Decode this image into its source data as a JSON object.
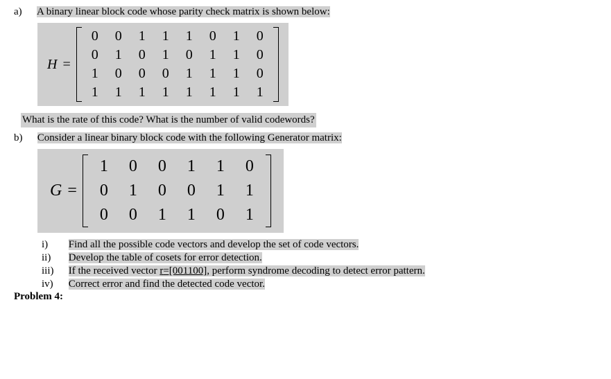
{
  "a": {
    "label": "a)",
    "intro": "A binary linear block code whose parity check matrix is shown below:",
    "matrixName": "H",
    "eq": "=",
    "H": [
      [
        "0",
        "0",
        "1",
        "1",
        "1",
        "0",
        "1",
        "0"
      ],
      [
        "0",
        "1",
        "0",
        "1",
        "0",
        "1",
        "1",
        "0"
      ],
      [
        "1",
        "0",
        "0",
        "0",
        "1",
        "1",
        "1",
        "0"
      ],
      [
        "1",
        "1",
        "1",
        "1",
        "1",
        "1",
        "1",
        "1"
      ]
    ],
    "question": "What is the rate of this code? What is the number of valid codewords?"
  },
  "b": {
    "label": "b)",
    "intro": "Consider a linear binary block code with the following Generator matrix:",
    "matrixName": "G",
    "eq": "=",
    "G": [
      [
        "1",
        "0",
        "0",
        "1",
        "1",
        "0"
      ],
      [
        "0",
        "1",
        "0",
        "0",
        "1",
        "1"
      ],
      [
        "0",
        "0",
        "1",
        "1",
        "0",
        "1"
      ]
    ],
    "sub": {
      "i": {
        "label": "i)",
        "text": "Find all the possible code vectors and develop the set of code vectors."
      },
      "ii": {
        "label": "ii)",
        "text": "Develop the table of cosets for error detection."
      },
      "iii": {
        "label": "iii)",
        "prefix": "If the received vector ",
        "r": "r",
        "rval": "=[001100]",
        "suffix": ", perform syndrome decoding to detect error pattern."
      },
      "iv": {
        "label": "iv)",
        "text": "Correct error and find the detected code vector."
      }
    }
  },
  "cutoff": "Problem 4:"
}
